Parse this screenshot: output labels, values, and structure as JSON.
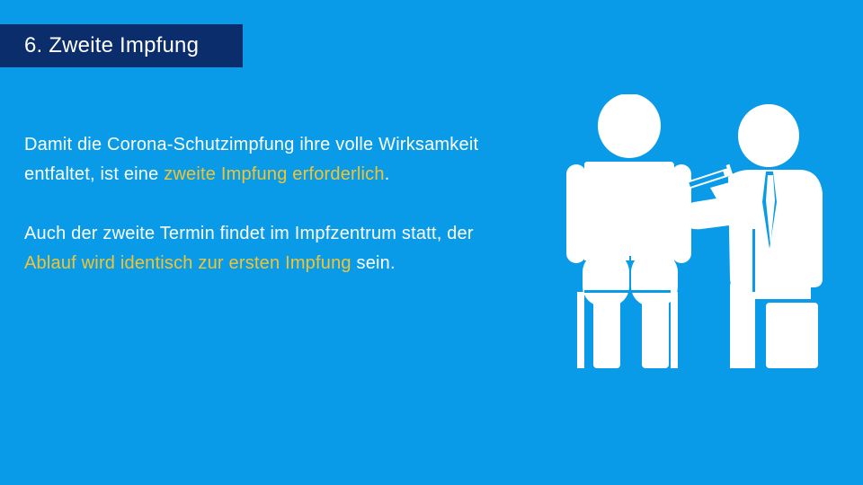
{
  "header": {
    "title": "6. Zweite Impfung"
  },
  "content": {
    "paragraph1": {
      "part1": "Damit die Corona-Schutzimpfung ihre volle Wirksamkeit entfaltet, ist eine ",
      "highlight": "zweite Impfung erforderlich",
      "part2": "."
    },
    "paragraph2": {
      "part1": "Auch der zweite Termin findet im Impfzentrum statt, der ",
      "highlight": "Ablauf wird identisch zur ersten Impfung",
      "part2": " sein."
    }
  },
  "illustration": {
    "icon": "vaccination-icon"
  },
  "colors": {
    "background": "#0a9be8",
    "title_background": "#0c2d6b",
    "text": "#ffffff",
    "highlight": "#f3c431"
  }
}
